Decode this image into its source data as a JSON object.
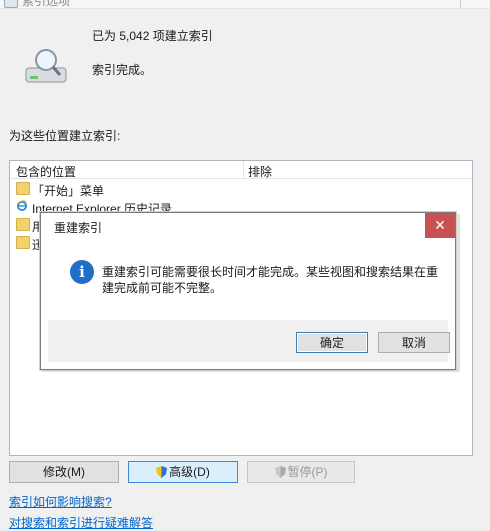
{
  "window": {
    "title": "索引选项"
  },
  "status": {
    "count_text": "已为 5,042 项建立索引",
    "state_text": "索引完成。"
  },
  "locations": {
    "section_label": "为这些位置建立索引:",
    "columns": {
      "included": "包含的位置",
      "exclude": "排除"
    },
    "rows": [
      {
        "label": "「开始」菜单",
        "icon": "folder-icon"
      },
      {
        "label": "Internet Explorer 历史记录",
        "icon": "ie-icon"
      },
      {
        "label": "用",
        "icon": "folder-icon"
      },
      {
        "label": "迅",
        "icon": "folder-icon"
      }
    ]
  },
  "dialog": {
    "title": "重建索引",
    "message": "重建索引可能需要很长时间才能完成。某些视图和搜索结果在重建完成前可能不完整。",
    "ok_label": "确定",
    "cancel_label": "取消",
    "close_glyph": "✕"
  },
  "buttons": {
    "modify": "修改(M)",
    "advanced": "高级(D)",
    "pause": "暂停(P)"
  },
  "links": {
    "how_indexing_affects_search": "索引如何影响搜索?",
    "troubleshoot": "对搜索和索引进行疑难解答"
  }
}
